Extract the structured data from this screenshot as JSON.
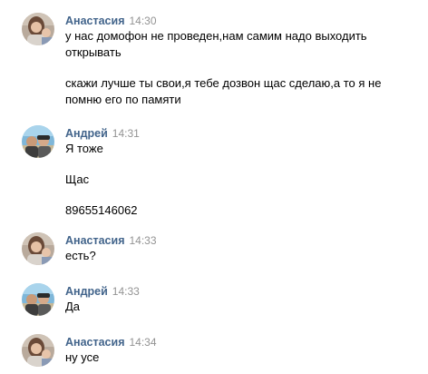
{
  "colors": {
    "author": "#42648b",
    "time": "#939393",
    "text": "#000000",
    "background": "#ffffff"
  },
  "messages": [
    {
      "author": "Анастасия",
      "time": "14:30",
      "avatar_icon": "user-avatar-anastasia-icon",
      "paragraphs": [
        "у нас домофон не проведен,нам самим надо выходить открывать",
        "скажи лучше ты свои,я тебе дозвон щас сделаю,а то я не помню его по памяти"
      ]
    },
    {
      "author": "Андрей",
      "time": "14:31",
      "avatar_icon": "user-avatar-andrey-icon",
      "paragraphs": [
        "Я тоже",
        "Щас",
        "89655146062"
      ]
    },
    {
      "author": "Анастасия",
      "time": "14:33",
      "avatar_icon": "user-avatar-anastasia-icon",
      "paragraphs": [
        "есть?"
      ]
    },
    {
      "author": "Андрей",
      "time": "14:33",
      "avatar_icon": "user-avatar-andrey-icon",
      "paragraphs": [
        "Да"
      ]
    },
    {
      "author": "Анастасия",
      "time": "14:34",
      "avatar_icon": "user-avatar-anastasia-icon",
      "paragraphs": [
        "ну усе"
      ]
    }
  ]
}
